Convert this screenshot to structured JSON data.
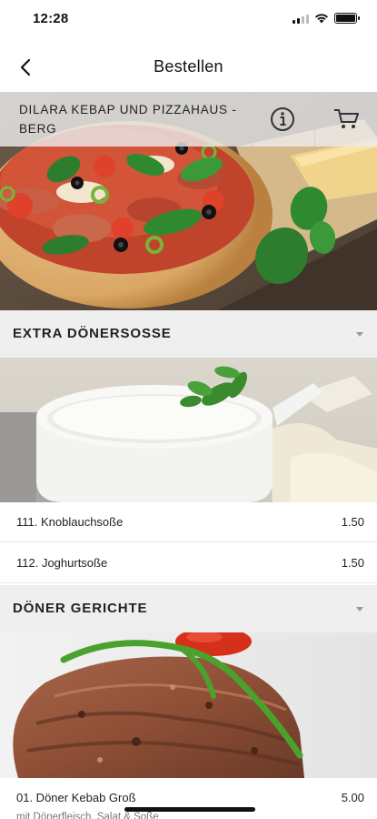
{
  "status_bar": {
    "time": "12:28",
    "icons": [
      "signal-icon",
      "wifi-icon",
      "battery-icon"
    ]
  },
  "nav": {
    "title": "Bestellen",
    "back_icon": "chevron-left-icon"
  },
  "restaurant": {
    "name": "DILARA KEBAP UND PIZZAHAUS - BERG",
    "info_icon": "info-icon",
    "cart_icon": "cart-icon"
  },
  "sections": [
    {
      "title": "EXTRA DÖNERSOSSE",
      "items": [
        {
          "name": "111. Knoblauchsoße",
          "price": "1.50"
        },
        {
          "name": "112. Joghurtsoße",
          "price": "1.50"
        }
      ]
    },
    {
      "title": "DÖNER GERICHTE",
      "items": [
        {
          "name": "01. Döner Kebab Groß",
          "price": "5.00",
          "description": "mit Dönerfleisch, Salat & Soße"
        }
      ]
    }
  ],
  "colors": {
    "section_bg": "#efefef",
    "header_bar": "#ebebeb",
    "text": "#222222"
  }
}
